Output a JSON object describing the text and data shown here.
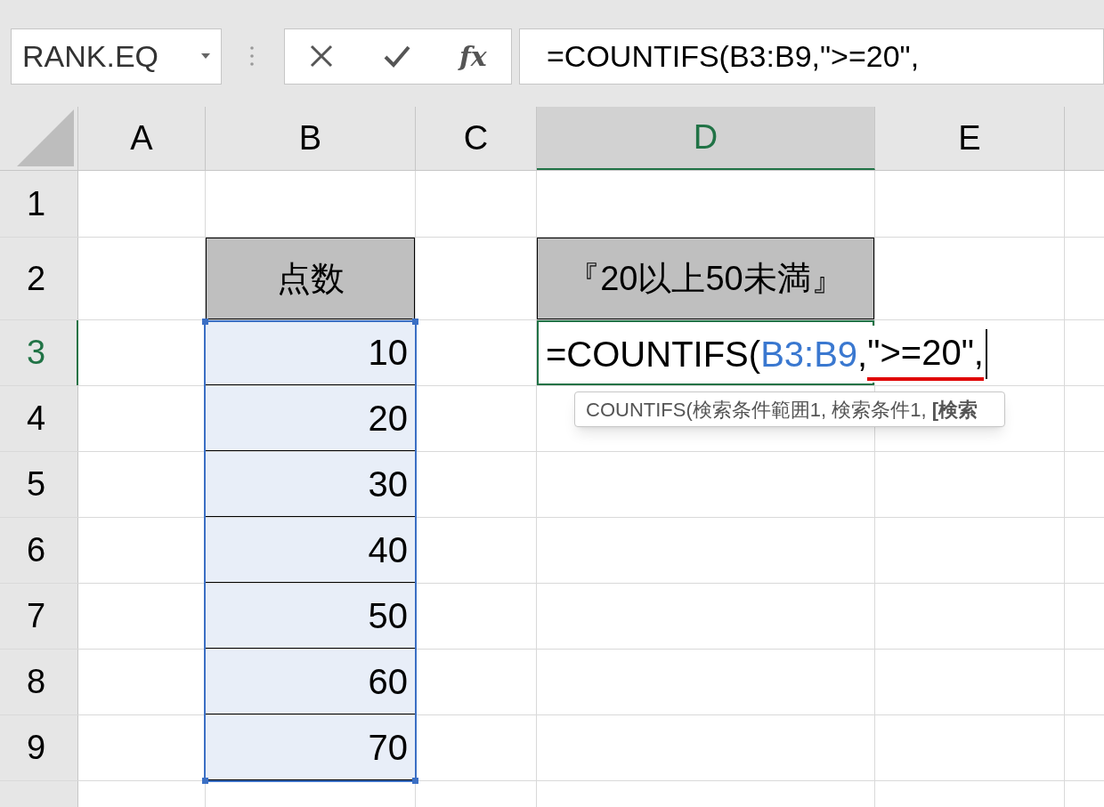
{
  "name_box": {
    "value": "RANK.EQ"
  },
  "formula_bar": {
    "function_label": "fx",
    "value": "=COUNTIFS(B3:B9,\">=20\","
  },
  "columns": [
    {
      "label": "A",
      "selected": false
    },
    {
      "label": "B",
      "selected": false
    },
    {
      "label": "C",
      "selected": false
    },
    {
      "label": "D",
      "selected": true
    },
    {
      "label": "E",
      "selected": false
    }
  ],
  "rows": [
    {
      "label": "1",
      "selected": false,
      "cells": {}
    },
    {
      "label": "2",
      "selected": false,
      "cells": {
        "B": {
          "kind": "header",
          "text": "点数"
        },
        "D": {
          "kind": "header",
          "text": "『20以上50未満』"
        }
      }
    },
    {
      "label": "3",
      "selected": true,
      "cells": {
        "B": {
          "kind": "number",
          "text": "10",
          "referenced": true
        },
        "D": {
          "kind": "editing",
          "parts": [
            {
              "text": "=COUNTIFS(",
              "kind": "plain",
              "underlined": false
            },
            {
              "text": "B3:B9",
              "kind": "reference",
              "underlined": false
            },
            {
              "text": ",",
              "kind": "plain",
              "underlined": false
            },
            {
              "text": "\">=20\",",
              "kind": "plain",
              "underlined": true
            }
          ]
        }
      }
    },
    {
      "label": "4",
      "selected": false,
      "cells": {
        "B": {
          "kind": "number",
          "text": "20",
          "referenced": true
        }
      }
    },
    {
      "label": "5",
      "selected": false,
      "cells": {
        "B": {
          "kind": "number",
          "text": "30",
          "referenced": true
        }
      }
    },
    {
      "label": "6",
      "selected": false,
      "cells": {
        "B": {
          "kind": "number",
          "text": "40",
          "referenced": true
        }
      }
    },
    {
      "label": "7",
      "selected": false,
      "cells": {
        "B": {
          "kind": "number",
          "text": "50",
          "referenced": true
        }
      }
    },
    {
      "label": "8",
      "selected": false,
      "cells": {
        "B": {
          "kind": "number",
          "text": "60",
          "referenced": true
        }
      }
    },
    {
      "label": "9",
      "selected": false,
      "cells": {
        "B": {
          "kind": "number",
          "text": "70",
          "referenced": true
        }
      }
    }
  ],
  "tooltip": {
    "text": "COUNTIFS(検索条件範囲1, 検索条件1, **[検索**"
  }
}
